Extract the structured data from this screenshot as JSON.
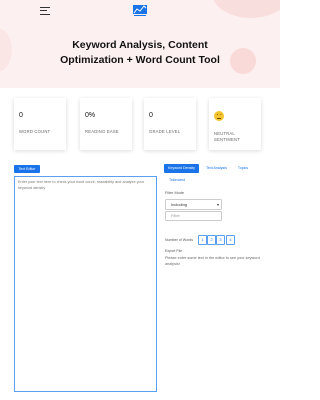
{
  "header": {
    "title_line1": "Keyword Analysis, Content",
    "title_line2": "Optimization + Word Count Tool"
  },
  "stats": [
    {
      "value": "0",
      "label": "WORD COUNT"
    },
    {
      "value": "0%",
      "label": "READING EASE"
    },
    {
      "value": "0",
      "label": "GRADE LEVEL"
    },
    {
      "label_line1": "NEUTRAL",
      "label_line2": "SENTIMENT",
      "icon": "neutral-face-icon"
    }
  ],
  "editor": {
    "tab_label": "Text Editor",
    "placeholder": "Enter your text here to check your word count, readability and analyze your keyword density"
  },
  "panel": {
    "tabs": [
      "Keyword Density",
      "Text Analysis",
      "Topics"
    ],
    "subtab": "Tokenized",
    "filter_mode_label": "Filter Mode",
    "filter_mode_value": "Including",
    "filter_placeholder": "Filter",
    "words_label": "Number of Words",
    "word_counts": [
      "1",
      "2",
      "3",
      "4"
    ],
    "export_label": "Export File",
    "empty_message": "Please enter some text in the editor to see your keyword analysis!"
  },
  "colors": {
    "accent": "#1a73e8",
    "hero_bg": "#fdf0f0"
  }
}
